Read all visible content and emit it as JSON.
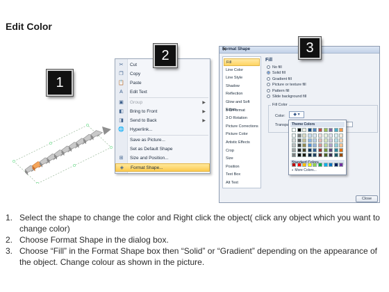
{
  "title": "Edit Color",
  "steps": {
    "one": "1",
    "two": "2",
    "three": "3"
  },
  "context_menu": {
    "items": [
      {
        "label": "Cut",
        "icon": "scissors-icon",
        "glyph": "✂",
        "disabled": false,
        "submenu": false
      },
      {
        "label": "Copy",
        "icon": "copy-icon",
        "glyph": "❐",
        "disabled": false,
        "submenu": false
      },
      {
        "label": "Paste",
        "icon": "paste-icon",
        "glyph": "📋",
        "disabled": false,
        "submenu": false
      },
      {
        "label": "Edit Text",
        "icon": "edit-text-icon",
        "glyph": "A",
        "disabled": false,
        "submenu": false
      },
      {
        "label": "Group",
        "icon": "group-icon",
        "glyph": "▣",
        "disabled": true,
        "submenu": true
      },
      {
        "label": "Bring to Front",
        "icon": "bring-front-icon",
        "glyph": "◧",
        "disabled": false,
        "submenu": true
      },
      {
        "label": "Send to Back",
        "icon": "send-back-icon",
        "glyph": "◨",
        "disabled": false,
        "submenu": true
      },
      {
        "label": "Hyperlink...",
        "icon": "hyperlink-icon",
        "glyph": "🌐",
        "disabled": false,
        "submenu": false
      },
      {
        "label": "Save as Picture...",
        "icon": "",
        "glyph": "",
        "disabled": false,
        "submenu": false
      },
      {
        "label": "Set as Default Shape",
        "icon": "",
        "glyph": "",
        "disabled": false,
        "submenu": false
      },
      {
        "label": "Size and Position...",
        "icon": "size-position-icon",
        "glyph": "⊞",
        "disabled": false,
        "submenu": false
      },
      {
        "label": "Format Shape...",
        "icon": "format-shape-icon",
        "glyph": "◈",
        "disabled": false,
        "submenu": false,
        "highlighted": true
      }
    ]
  },
  "dialog": {
    "title": "Format Shape",
    "nav": [
      "Fill",
      "Line Color",
      "Line Style",
      "Shadow",
      "Reflection",
      "Glow and Soft Edges",
      "3-D Format",
      "3-D Rotation",
      "Picture Corrections",
      "Picture Color",
      "Artistic Effects",
      "Crop",
      "Size",
      "Position",
      "Text Box",
      "Alt Text"
    ],
    "fill_heading": "Fill",
    "options": [
      "No fill",
      "Solid fill",
      "Gradient fill",
      "Picture or texture fill",
      "Pattern fill",
      "Slide background fill"
    ],
    "fill_color_legend": "Fill Color",
    "color_label": "Color:",
    "transparency_label": "Transpa",
    "palette_theme_label": "Theme Colors",
    "palette_standard_label": "Standard Colors",
    "palette_more": "More Colors...",
    "close_label": "Close"
  },
  "palette_colors": {
    "theme_top": [
      "#ffffff",
      "#000000",
      "#eeece1",
      "#1f497d",
      "#4f81bd",
      "#c0504d",
      "#9bbb59",
      "#8064a2",
      "#4bacc6",
      "#f79646"
    ],
    "theme_cols": [
      [
        "#f2f2f2",
        "#d8d8d8",
        "#bfbfbf",
        "#a5a5a5",
        "#7f7f7f"
      ],
      [
        "#7f7f7f",
        "#595959",
        "#3f3f3f",
        "#262626",
        "#0c0c0c"
      ],
      [
        "#ddd9c3",
        "#c4bd97",
        "#938953",
        "#494429",
        "#1d1b10"
      ],
      [
        "#c6d9f0",
        "#8db3e2",
        "#548dd4",
        "#17365d",
        "#0f243e"
      ],
      [
        "#dbe5f1",
        "#b8cce4",
        "#95b3d7",
        "#366092",
        "#244061"
      ],
      [
        "#f2dcdb",
        "#e5b9b7",
        "#d99694",
        "#953734",
        "#632423"
      ],
      [
        "#ebf1dd",
        "#d7e3bc",
        "#c3d69b",
        "#76923c",
        "#4f6128"
      ],
      [
        "#e5e0ec",
        "#ccc1d9",
        "#b2a2c7",
        "#5f497a",
        "#3f3151"
      ],
      [
        "#dbeef3",
        "#b7dde8",
        "#92cddc",
        "#31859b",
        "#205867"
      ],
      [
        "#fdeada",
        "#fbd5b5",
        "#fac08f",
        "#e36c09",
        "#974806"
      ]
    ],
    "standard": [
      "#c00000",
      "#ff0000",
      "#ffc000",
      "#ffff00",
      "#92d050",
      "#00b050",
      "#00b0f0",
      "#0070c0",
      "#002060",
      "#7030a0"
    ]
  },
  "instructions": [
    {
      "num": "1.",
      "text": "Select the shape to change the color and Right click the object( click any object which you want to change color)"
    },
    {
      "num": "2.",
      "text": "Choose Format Shape in the dialog box."
    },
    {
      "num": "3.",
      "text": "Choose “Fill” in the Format Shape box then “Solid” or “Gradient” depending on the appearance of the object. Change colour as shown in the picture."
    }
  ]
}
